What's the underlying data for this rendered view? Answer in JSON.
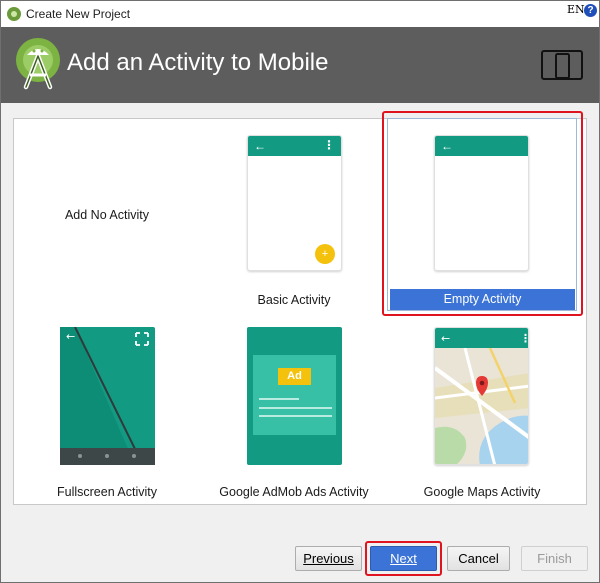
{
  "window": {
    "title": "Create New Project",
    "language_indicator": "EN",
    "help_glyph": "?"
  },
  "header": {
    "title": "Add an Activity to Mobile",
    "logo_icon": "android-studio-logo-icon",
    "device_icon": "tablet-phone-icon"
  },
  "activities": [
    {
      "label": "Add No Activity",
      "selected": false
    },
    {
      "label": "Basic Activity",
      "selected": false
    },
    {
      "label": "Empty Activity",
      "selected": true
    },
    {
      "label": "Fullscreen Activity",
      "selected": false
    },
    {
      "label": "Google AdMob Ads Activity",
      "selected": false
    },
    {
      "label": "Google Maps Activity",
      "selected": false
    }
  ],
  "preview": {
    "fab_glyph": "+",
    "ad_label": "Ad",
    "back_glyph": "←",
    "more_glyph": "⋮"
  },
  "buttons": {
    "previous": "Previous",
    "next": "Next",
    "cancel": "Cancel",
    "finish": "Finish"
  },
  "colors": {
    "header_bg": "#5d5d5d",
    "teal": "#129a83",
    "selection_blue": "#3b74d6",
    "highlight_red": "#e0141e",
    "fab_yellow": "#f4c20d"
  }
}
